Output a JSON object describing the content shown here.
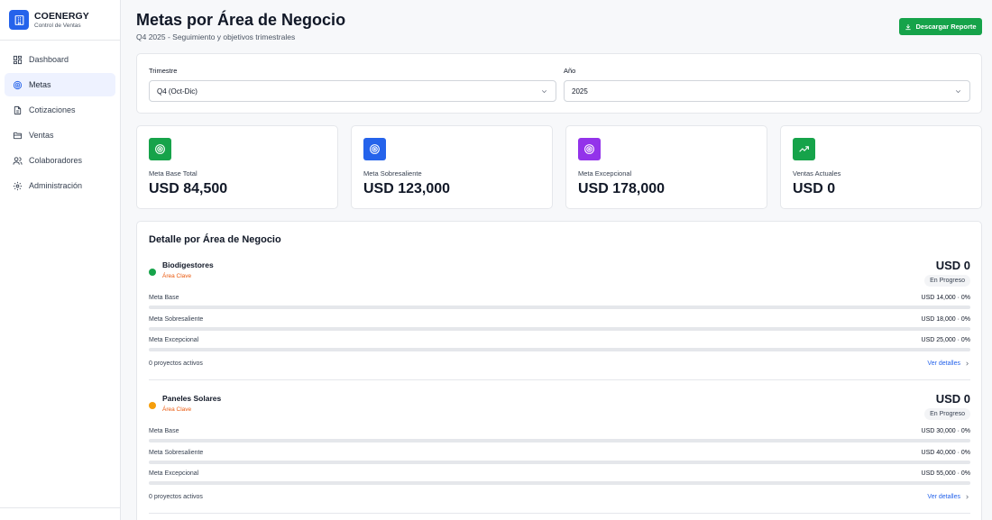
{
  "brand": {
    "name": "COENERGY",
    "subtitle": "Control de Ventas"
  },
  "nav": [
    {
      "label": "Dashboard",
      "icon": "dashboard-icon",
      "active": false
    },
    {
      "label": "Metas",
      "icon": "target-icon",
      "active": true
    },
    {
      "label": "Cotizaciones",
      "icon": "document-icon",
      "active": false
    },
    {
      "label": "Ventas",
      "icon": "folder-icon",
      "active": false
    },
    {
      "label": "Colaboradores",
      "icon": "users-icon",
      "active": false
    },
    {
      "label": "Administración",
      "icon": "gear-icon",
      "active": false
    }
  ],
  "header": {
    "title": "Metas por Área de Negocio",
    "subtitle": "Q4 2025 - Seguimiento y objetivos trimestrales",
    "download_label": "Descargar Reporte"
  },
  "filters": {
    "quarter_label": "Trimestre",
    "quarter_value": "Q4 (Oct-Dic)",
    "year_label": "Año",
    "year_value": "2025"
  },
  "stats": [
    {
      "label": "Meta Base Total",
      "value": "USD 84,500",
      "color": "#16a34a",
      "icon": "target-icon"
    },
    {
      "label": "Meta Sobresaliente",
      "value": "USD 123,000",
      "color": "#2563eb",
      "icon": "target-icon"
    },
    {
      "label": "Meta Excepcional",
      "value": "USD 178,000",
      "color": "#9333ea",
      "icon": "target-icon"
    },
    {
      "label": "Ventas Actuales",
      "value": "USD 0",
      "color": "#16a34a",
      "icon": "trending-up-icon"
    }
  ],
  "detail": {
    "title": "Detalle por Área de Negocio",
    "areas": [
      {
        "name": "Biodigestores",
        "tag": "Área Clave",
        "dot_color": "#16a34a",
        "total": "USD 0",
        "status": "En Progreso",
        "metas": [
          {
            "label": "Meta Base",
            "value": "USD 14,000 · 0%",
            "progress": 0
          },
          {
            "label": "Meta Sobresaliente",
            "value": "USD 18,000 · 0%",
            "progress": 0
          },
          {
            "label": "Meta Excepcional",
            "value": "USD 25,000 · 0%",
            "progress": 0
          }
        ],
        "projects": "0 proyectos activos",
        "details_link": "Ver detalles"
      },
      {
        "name": "Paneles Solares",
        "tag": "Área Clave",
        "dot_color": "#f59e0b",
        "total": "USD 0",
        "status": "En Progreso",
        "metas": [
          {
            "label": "Meta Base",
            "value": "USD 30,000 · 0%",
            "progress": 0
          },
          {
            "label": "Meta Sobresaliente",
            "value": "USD 40,000 · 0%",
            "progress": 0
          },
          {
            "label": "Meta Excepcional",
            "value": "USD 55,000 · 0%",
            "progress": 0
          }
        ],
        "projects": "0 proyectos activos",
        "details_link": "Ver detalles"
      }
    ]
  }
}
